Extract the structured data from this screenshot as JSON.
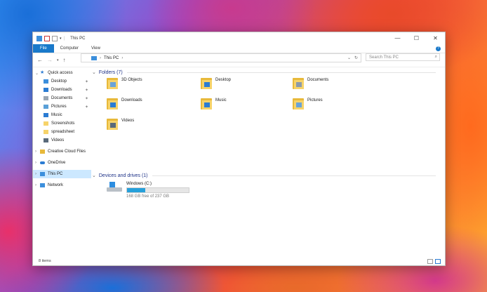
{
  "window": {
    "title": "This PC"
  },
  "titlebar": {
    "controls": {
      "minimize": "—",
      "maximize": "☐",
      "close": "✕"
    }
  },
  "ribbon": {
    "tabs": [
      "File",
      "Computer",
      "View"
    ],
    "help": "?"
  },
  "address": {
    "path": [
      "This PC"
    ],
    "search_placeholder": "Search This PC"
  },
  "nav": {
    "quick_access": "Quick access",
    "quick_items": [
      {
        "label": "Desktop",
        "icon": "desktop-icon",
        "pinned": true
      },
      {
        "label": "Downloads",
        "icon": "downloads-icon",
        "pinned": true
      },
      {
        "label": "Documents",
        "icon": "documents-icon",
        "pinned": true
      },
      {
        "label": "Pictures",
        "icon": "pictures-icon",
        "pinned": true
      },
      {
        "label": "Music",
        "icon": "music-icon",
        "pinned": false
      },
      {
        "label": "Screenshots",
        "icon": "folder-icon",
        "pinned": false
      },
      {
        "label": "spreadsheet",
        "icon": "folder-icon",
        "pinned": false
      },
      {
        "label": "Videos",
        "icon": "videos-icon",
        "pinned": false
      }
    ],
    "creative_cloud": "Creative Cloud Files",
    "onedrive": "OneDrive",
    "this_pc": "This PC",
    "network": "Network"
  },
  "main": {
    "folders_header": "Folders (7)",
    "folders": [
      {
        "label": "3D Objects",
        "icon": "3d-objects-icon"
      },
      {
        "label": "Desktop",
        "icon": "desktop-folder-icon"
      },
      {
        "label": "Documents",
        "icon": "documents-folder-icon"
      },
      {
        "label": "Downloads",
        "icon": "downloads-folder-icon"
      },
      {
        "label": "Music",
        "icon": "music-folder-icon"
      },
      {
        "label": "Pictures",
        "icon": "pictures-folder-icon"
      },
      {
        "label": "Videos",
        "icon": "videos-folder-icon"
      }
    ],
    "devices_header": "Devices and drives (1)",
    "drive": {
      "name": "Windows (C:)",
      "free": "168 GB free of 237 GB",
      "used_fraction": 0.29
    }
  },
  "status": {
    "items": "8 items"
  },
  "colors": {
    "accent": "#1979ca",
    "selection": "#cce8ff",
    "folder": "#f6d36a"
  }
}
